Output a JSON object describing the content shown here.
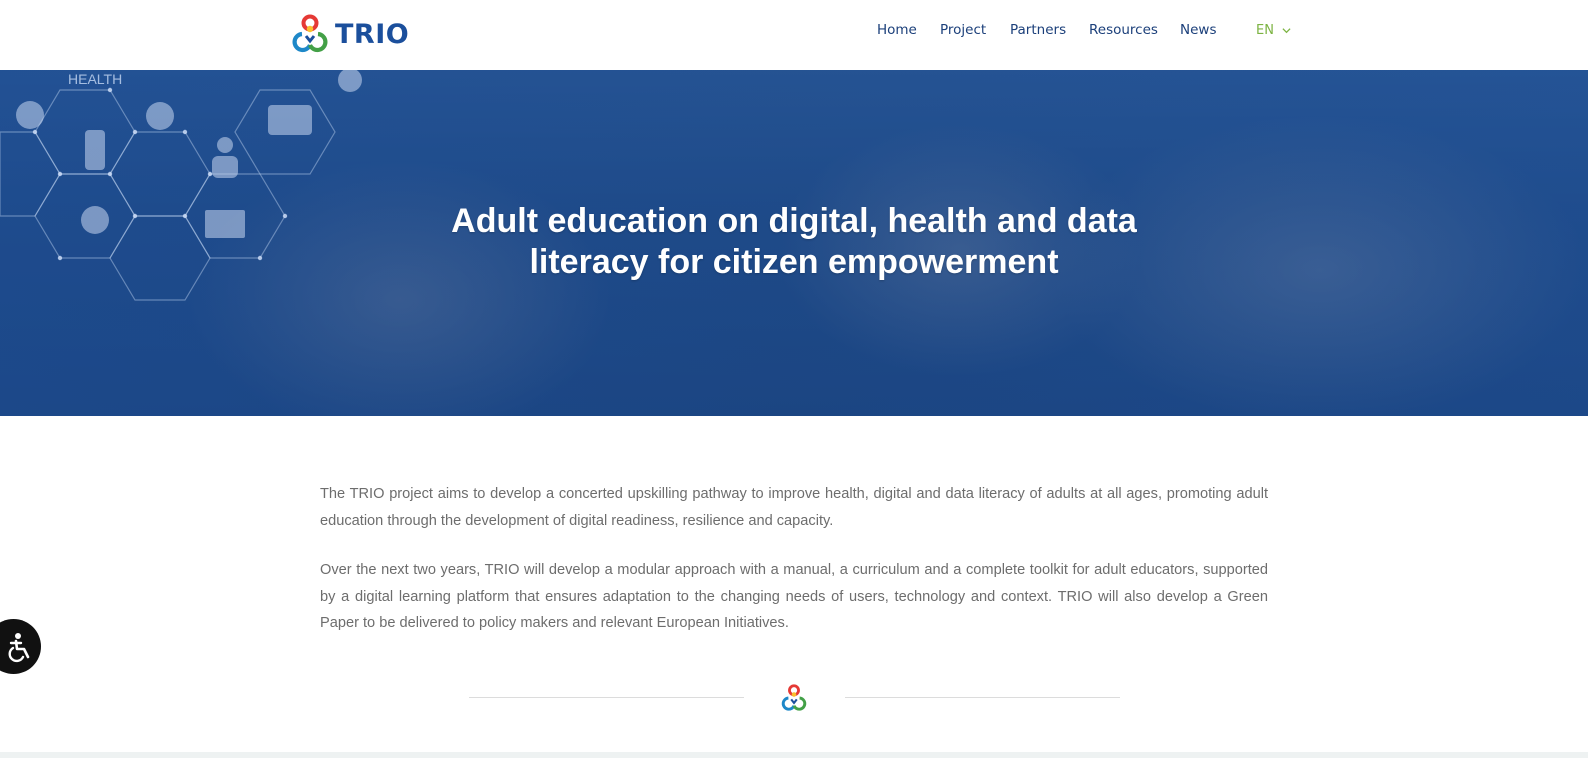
{
  "header": {
    "logo_text": "TRIO",
    "nav": [
      {
        "label": "Home"
      },
      {
        "label": "Project"
      },
      {
        "label": "Partners"
      },
      {
        "label": "Resources"
      },
      {
        "label": "News"
      }
    ],
    "language": "EN"
  },
  "hero": {
    "deco_label": "HEALTH",
    "title": "Adult education on digital, health and data literacy for citizen empowerment"
  },
  "content": {
    "paragraphs": [
      "The TRIO project aims to develop a concerted upskilling pathway to improve health, digital and data literacy of adults at all ages, promoting adult education through the development of digital readiness, resilience and capacity.",
      "Over the next two years, TRIO will develop a modular approach with a manual, a curriculum and a complete toolkit for adult educators, supported by a digital learning platform that ensures adaptation to the changing needs of  users, technology and context. TRIO will also develop a Green Paper to be delivered to policy makers and relevant European Initiatives."
    ]
  },
  "colors": {
    "brand_blue": "#1b4f9c",
    "nav_text": "#1b3f7a",
    "lang_green": "#7cb342",
    "logo_red": "#e53935",
    "logo_yellow": "#fbc02d",
    "logo_green": "#43a047",
    "logo_teal": "#1e88c8",
    "body_text": "#6d6d6d"
  },
  "icons": {
    "logo": "trio-logo-icon",
    "chevron": "chevron-down-icon",
    "accessibility": "accessibility-icon"
  }
}
